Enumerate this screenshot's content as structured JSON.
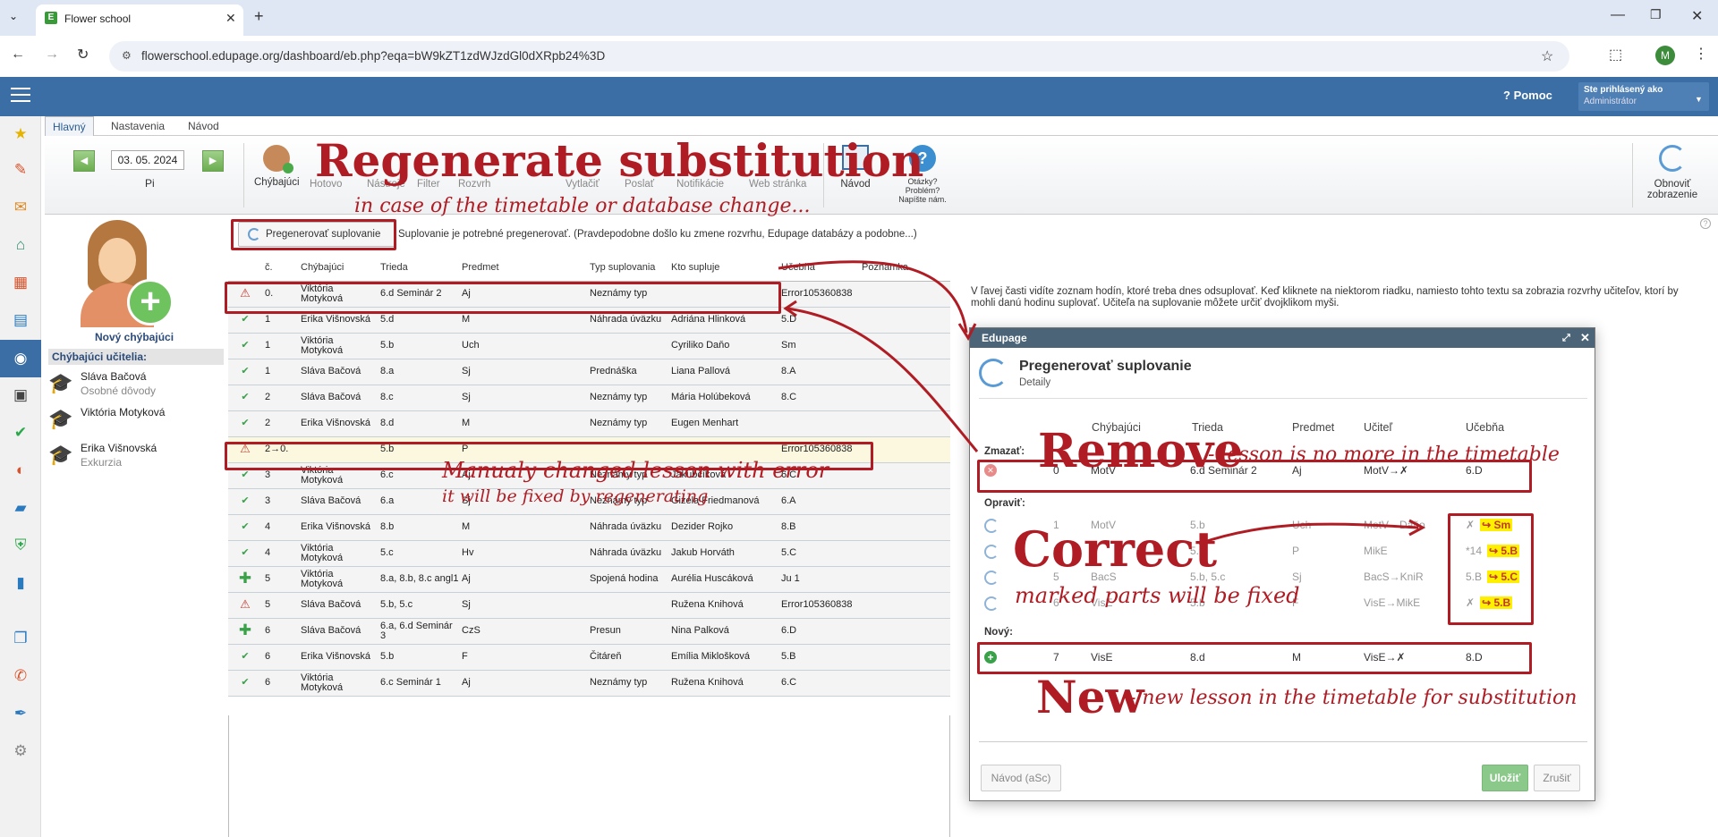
{
  "browser": {
    "tab_title": "Flower school",
    "url": "flowerschool.edupage.org/dashboard/eb.php?eqa=bW9kZT1zdWJzdGl0dXRpb24%3D",
    "avatar_letter": "M"
  },
  "header": {
    "help_label": "Pomoc",
    "logged_as": "Ste prihlásený ako",
    "role": "Administrátor"
  },
  "ribbon": {
    "tabs": [
      "Hlavný",
      "Nastavenia",
      "Návod"
    ],
    "date": "03. 05. 2024",
    "day": "Pi",
    "buttons": {
      "absent": "Chýbajúci",
      "done": "Hotovo",
      "tools": "Nástroje",
      "filter": "Filter",
      "timetable": "Rozvrh",
      "print": "Vytlačiť",
      "send": "Poslať",
      "notifications": "Notifikácie",
      "web": "Web stránka",
      "guide": "Návod",
      "questions_1": "Otázky?",
      "questions_2": "Problém?",
      "questions_3": "Napíšte nám.",
      "refresh_1": "Obnoviť",
      "refresh_2": "zobrazenie"
    }
  },
  "regen_button": "Pregenerovať suplovanie",
  "regen_notice": "Suplovanie je potrebné pregenerovať. (Pravdepodobne došlo ku zmene rozvrhu, Edupage databázy a podobne...)",
  "left_panel": {
    "new_absent": "Nový chýbajúci",
    "absent_teachers_title": "Chýbajúci učitelia:",
    "teachers": [
      {
        "name": "Sláva Bačová",
        "reason": "Osobné dôvody"
      },
      {
        "name": "Viktória Motyková",
        "reason": ""
      },
      {
        "name": "Erika Višnovská",
        "reason": "Exkurzia"
      }
    ]
  },
  "table": {
    "headers": [
      "č.",
      "Chýbajúci",
      "Trieda",
      "Predmet",
      "Typ suplovania",
      "Kto supluje",
      "Učebňa",
      "Poznámka"
    ],
    "rows": [
      {
        "icon": "warning",
        "hl": false,
        "c": [
          "0.",
          "Viktória Motyková",
          "6.d Seminár 2",
          "Aj",
          "Neznámy typ",
          "",
          "Error105360838",
          ""
        ]
      },
      {
        "icon": "check",
        "hl": false,
        "c": [
          "1",
          "Erika Višnovská",
          "5.d",
          "M",
          "Náhrada úväzku",
          "Adriána Hlinková",
          "5.D",
          ""
        ]
      },
      {
        "icon": "check",
        "hl": false,
        "c": [
          "1",
          "Viktória Motyková",
          "5.b",
          "Uch",
          "",
          "Cyriliko Daňo",
          "Sm",
          ""
        ]
      },
      {
        "icon": "check",
        "hl": false,
        "c": [
          "1",
          "Sláva Bačová",
          "8.a",
          "Sj",
          "Prednáška",
          "Liana Pallová",
          "8.A",
          ""
        ]
      },
      {
        "icon": "check",
        "hl": false,
        "c": [
          "2",
          "Sláva Bačová",
          "8.c",
          "Sj",
          "Neznámy typ",
          "Mária Holúbeková",
          "8.C",
          ""
        ]
      },
      {
        "icon": "check",
        "hl": false,
        "c": [
          "2",
          "Erika Višnovská",
          "8.d",
          "M",
          "Neznámy typ",
          "Eugen Menhart",
          "",
          ""
        ]
      },
      {
        "icon": "warning",
        "hl": true,
        "c": [
          "2→0.",
          "",
          "5.b",
          "P",
          "",
          "",
          "Error105360838",
          ""
        ]
      },
      {
        "icon": "check",
        "hl": false,
        "c": [
          "3",
          "Viktória Motyková",
          "6.c",
          "Aj",
          "Neznámy typ",
          "Jakubčíková",
          "6.C",
          ""
        ]
      },
      {
        "icon": "check",
        "hl": false,
        "c": [
          "3",
          "Sláva Bačová",
          "6.a",
          "Sj",
          "Neznámy typ",
          "Gizela Friedmanová",
          "6.A",
          ""
        ]
      },
      {
        "icon": "check",
        "hl": false,
        "c": [
          "4",
          "Erika Višnovská",
          "8.b",
          "M",
          "Náhrada úväzku",
          "Dezider Rojko",
          "8.B",
          ""
        ]
      },
      {
        "icon": "check",
        "hl": false,
        "c": [
          "4",
          "Viktória Motyková",
          "5.c",
          "Hv",
          "Náhrada úväzku",
          "Jakub Horváth",
          "5.C",
          ""
        ]
      },
      {
        "icon": "plus",
        "hl": false,
        "c": [
          "5",
          "Viktória Motyková",
          "8.a, 8.b, 8.c angl1",
          "Aj",
          "Spojená hodina",
          "Aurélia Huscáková",
          "Ju 1",
          ""
        ]
      },
      {
        "icon": "warning",
        "hl": false,
        "c": [
          "5",
          "Sláva Bačová",
          "5.b, 5.c",
          "Sj",
          "",
          "Ružena Knihová",
          "Error105360838",
          ""
        ]
      },
      {
        "icon": "plus",
        "hl": false,
        "c": [
          "6",
          "Sláva Bačová",
          "6.a, 6.d Seminár 3",
          "CzS",
          "Presun",
          "Nina Palková",
          "6.D",
          ""
        ]
      },
      {
        "icon": "check",
        "hl": false,
        "c": [
          "6",
          "Erika Višnovská",
          "5.b",
          "F",
          "Čitáreň",
          "Emília Miklošková",
          "5.B",
          ""
        ]
      },
      {
        "icon": "check",
        "hl": false,
        "c": [
          "6",
          "Viktória Motyková",
          "6.c Seminár 1",
          "Aj",
          "Neznámy typ",
          "Ružena Knihová",
          "6.C",
          ""
        ]
      }
    ]
  },
  "right_info": "V ľavej časti vidíte zoznam hodín, ktoré treba dnes odsuplovať. Keď kliknete na niektorom riadku, namiesto tohto textu sa zobrazia rozvrhy učiteľov, ktorí by mohli danú hodinu suplovať. Učiteľa na suplovanie môžete určiť dvojklikom myši.",
  "dialog": {
    "window_title": "Edupage",
    "title": "Pregenerovať suplovanie",
    "subtitle": "Detaily",
    "headers": [
      "Chýbajúci",
      "Trieda",
      "Predmet",
      "Učiteľ",
      "Učebňa"
    ],
    "remove_label": "Zmazať:",
    "remove_row": {
      "n": "0",
      "absent": "MotV",
      "class": "6.d Seminár 2",
      "subject": "Aj",
      "teacher": "MotV→✗",
      "room": "6.D"
    },
    "fix_label": "Opraviť:",
    "fix_rows": [
      {
        "n": "1",
        "absent": "MotV",
        "class": "5.b",
        "subject": "Uch",
        "teacher": "MotV→Daňo",
        "room_old": "✗",
        "room_new": "↪ Sm"
      },
      {
        "n": "2",
        "absent": "",
        "class": "5.b",
        "subject": "P",
        "teacher": "MikE",
        "room_old": "*14",
        "room_new": "↪ 5.B"
      },
      {
        "n": "5",
        "absent": "BacS",
        "class": "5.b, 5.c",
        "subject": "Sj",
        "teacher": "BacS→KniR",
        "room_old": "5.B",
        "room_new": "↪ 5.C"
      },
      {
        "n": "6",
        "absent": "VisE",
        "class": "5.b",
        "subject": "F",
        "teacher": "VisE→MikE",
        "room_old": "✗",
        "room_new": "↪ 5.B"
      }
    ],
    "new_label": "Nový:",
    "new_row": {
      "n": "7",
      "absent": "VisE",
      "class": "8.d",
      "subject": "M",
      "teacher": "VisE→✗",
      "room": "8.D"
    },
    "help_button": "Návod (aSc)",
    "save_button": "Uložiť",
    "cancel_button": "Zrušiť"
  },
  "annotations": {
    "regen_title": "Regenerate substitution",
    "regen_sub": "in case of the timetable or database change...",
    "manual_1": "Manualy changed lesson with error",
    "manual_2": "it will be fixed by regenerating",
    "remove_big": "Remove",
    "remove_small": "- lesson is no more in the timetable",
    "correct_big": "Correct",
    "correct_small": "marked parts will be fixed",
    "new_big": "New",
    "new_small": "- new lesson in the timetable for substitution"
  },
  "colors": {
    "header_blue": "#3b6ea5",
    "annotation_red": "#b01c24",
    "highlight_yellow": "#fff000",
    "save_green": "#8bc98b"
  }
}
